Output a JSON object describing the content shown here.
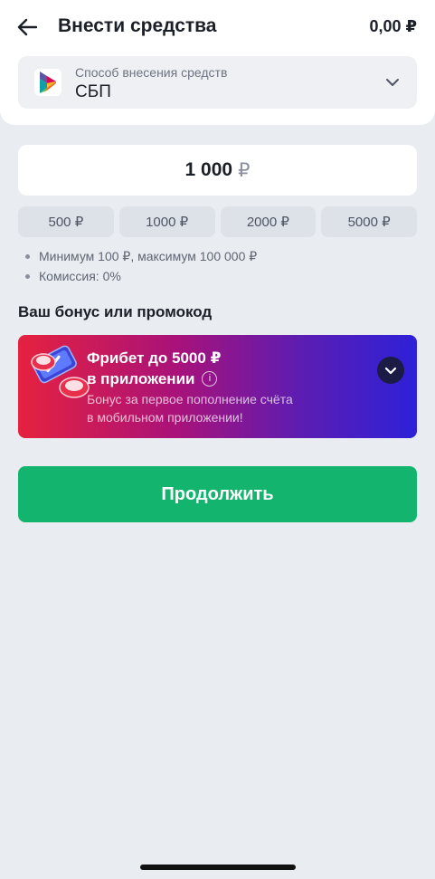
{
  "header": {
    "title": "Внести средства",
    "balance": "0,00 ₽",
    "back_icon": "arrow-left-icon"
  },
  "payment_method": {
    "caption": "Способ внесения средств",
    "value": "СБП",
    "logo_icon": "sbp-logo-icon",
    "chevron_icon": "chevron-down-icon"
  },
  "amount": {
    "value": "1 000",
    "currency": "₽"
  },
  "quick_amounts": [
    "500 ₽",
    "1000 ₽",
    "2000 ₽",
    "5000 ₽"
  ],
  "limits": [
    "Минимум 100 ₽, максимум 100 000 ₽",
    "Комиссия: 0%"
  ],
  "bonus": {
    "heading": "Ваш бонус или промокод",
    "promo": {
      "title_line1": "Фрибет до 5000 ₽",
      "title_line2": "в приложении",
      "info_glyph": "i",
      "desc_line1": "Бонус за первое пополнение счёта",
      "desc_line2": "в мобильном приложении!",
      "colors": {
        "gradient_start": "#e6213f",
        "gradient_end": "#2e21d8"
      }
    }
  },
  "actions": {
    "continue_label": "Продолжить",
    "continue_color": "#13b56e"
  }
}
